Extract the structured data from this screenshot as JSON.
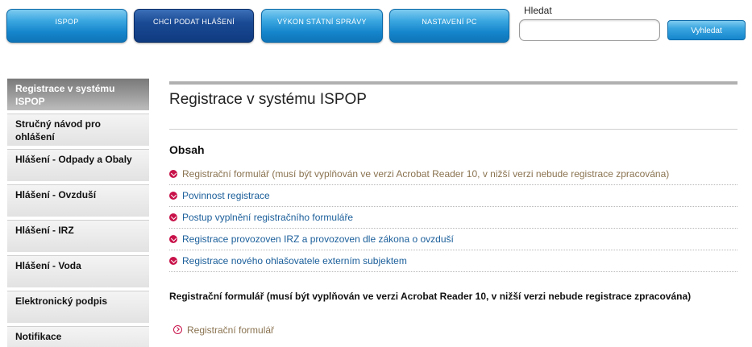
{
  "nav": {
    "tabs": [
      {
        "label": "ISPOP"
      },
      {
        "label": "CHCI PODAT HLÁŠENÍ"
      },
      {
        "label": "VÝKON STÁTNÍ SPRÁVY"
      },
      {
        "label": "NASTAVENÍ PC"
      }
    ]
  },
  "search": {
    "label": "Hledat",
    "value": "",
    "button_label": "Vyhledat"
  },
  "sidebar": {
    "items": [
      {
        "label": "Registrace v systému ISPOP",
        "active": true
      },
      {
        "label": "Stručný návod pro ohlášení"
      },
      {
        "label": "Hlášení - Odpady a Obaly"
      },
      {
        "label": "Hlášení - Ovzduší"
      },
      {
        "label": "Hlášení - IRZ"
      },
      {
        "label": "Hlášení - Voda"
      },
      {
        "label": "Elektronický podpis"
      },
      {
        "label": "Notifikace"
      }
    ]
  },
  "main": {
    "title": "Registrace v systému ISPOP",
    "contents_heading": "Obsah",
    "toc": [
      {
        "label": "Registrační formulář (musí být vyplňován ve verzi Acrobat Reader 10, v nižší verzi nebude registrace zpracována)"
      },
      {
        "label": "Povinnost registrace"
      },
      {
        "label": "Postup vyplnění registračního formuláře"
      },
      {
        "label": "Registrace provozoven IRZ a provozoven dle zákona o ovzduší"
      },
      {
        "label": "Registrace nového ohlašovatele externím subjektem"
      }
    ],
    "section_heading": "Registrační formulář (musí být vyplňován ve verzi Acrobat Reader 10, v nižší verzi nebude registrace zpracována)",
    "download_link": "Registrační formulář"
  },
  "colors": {
    "tab_blue": "#1585cc",
    "tab_active": "#0f3a80",
    "bullet_red": "#c8124a",
    "link_blue": "#1a5e9a",
    "link_visited": "#8a7350"
  },
  "icons": {
    "toc_bullet": "chevron-down-circle-icon",
    "download_bullet": "chevron-right-circle-icon"
  }
}
